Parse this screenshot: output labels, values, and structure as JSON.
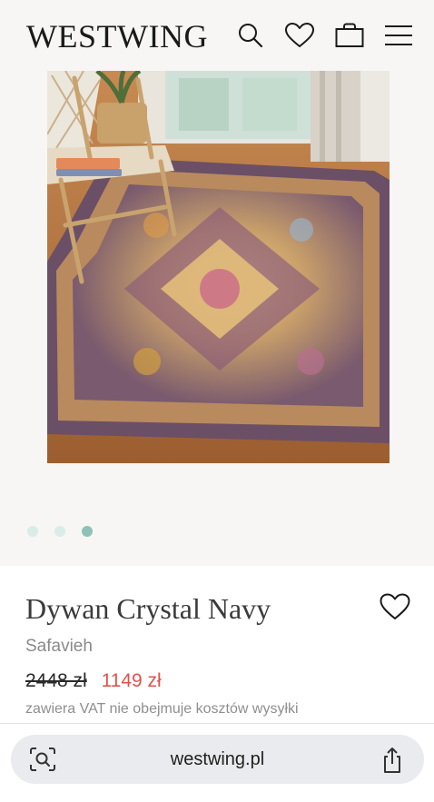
{
  "header": {
    "logo": "WESTWING",
    "icons": [
      "search-icon",
      "heart-icon",
      "bag-icon",
      "menu-icon"
    ]
  },
  "gallery": {
    "image": "rug-with-wooden-chair",
    "slide_count": 3,
    "active_slide": 3
  },
  "product": {
    "title": "Dywan Crystal Navy",
    "brand": "Safavieh",
    "old_price": "2448 zł",
    "new_price": "1149 zł",
    "vat_note": "zawiera VAT nie obejmuje kosztów wysyłki"
  },
  "browser": {
    "url": "westwing.pl",
    "icons": [
      "page-lens-icon",
      "share-icon"
    ]
  },
  "colors": {
    "accent_dot": "#8cc3b6",
    "sale_price": "#e0524a"
  }
}
